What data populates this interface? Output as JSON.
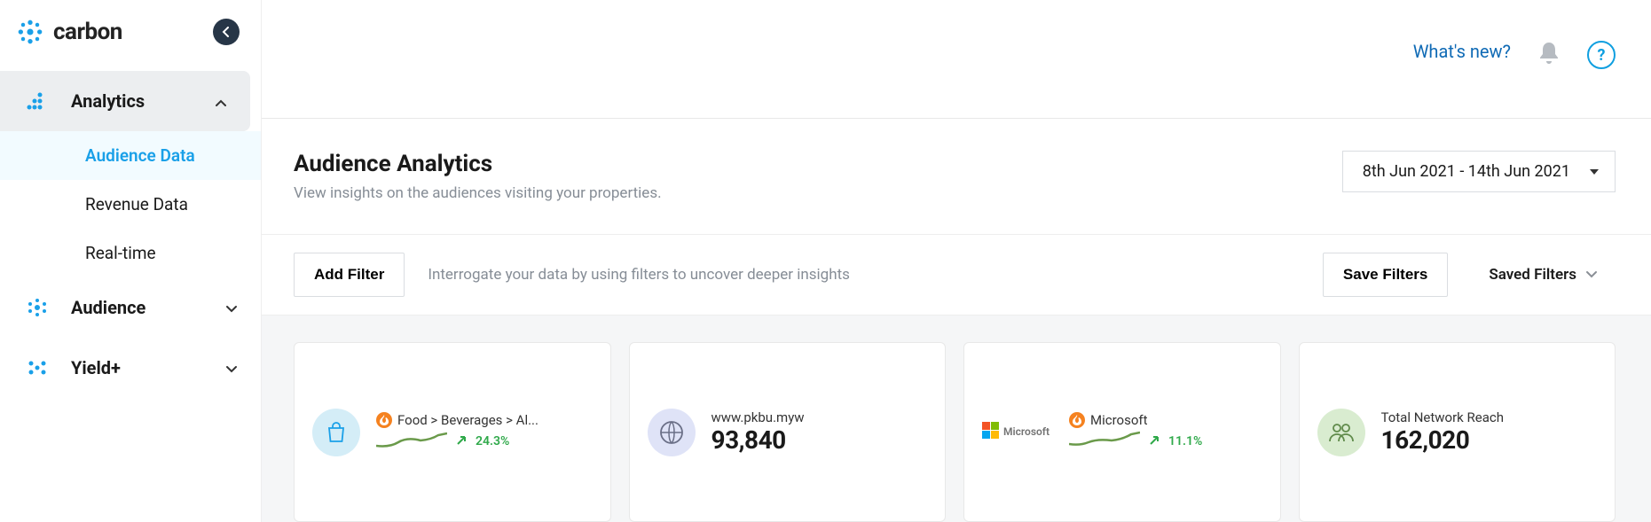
{
  "brand": {
    "name": "carbon"
  },
  "sidebar": {
    "nav": [
      {
        "label": "Analytics",
        "expanded": true,
        "children": [
          {
            "label": "Audience Data",
            "active": true
          },
          {
            "label": "Revenue Data"
          },
          {
            "label": "Real-time"
          }
        ]
      },
      {
        "label": "Audience"
      },
      {
        "label": "Yield+"
      }
    ]
  },
  "topbar": {
    "whats_new": "What's new?"
  },
  "header": {
    "title": "Audience Analytics",
    "subtitle": "View insights on the audiences visiting your properties.",
    "date_range": "8th Jun 2021 - 14th Jun 2021"
  },
  "filters": {
    "add_label": "Add Filter",
    "hint": "Interrogate your data by using filters to uncover deeper insights",
    "save_label": "Save Filters",
    "saved_label": "Saved Filters"
  },
  "cards": [
    {
      "kind": "trend",
      "icon": "shopping-bag",
      "icon_bg": "#d4edf7",
      "hot": true,
      "label": "Food > Beverages > Al...",
      "delta": "24.3%"
    },
    {
      "kind": "metric",
      "icon": "globe",
      "icon_bg": "#dfe3f7",
      "label": "www.pkbu.myw",
      "value": "93,840"
    },
    {
      "kind": "trend",
      "icon": "microsoft",
      "hot": true,
      "label": "Microsoft",
      "delta": "11.1%"
    },
    {
      "kind": "metric",
      "icon": "people",
      "icon_bg": "#d9ecd0",
      "label": "Total Network Reach",
      "value": "162,020"
    }
  ]
}
